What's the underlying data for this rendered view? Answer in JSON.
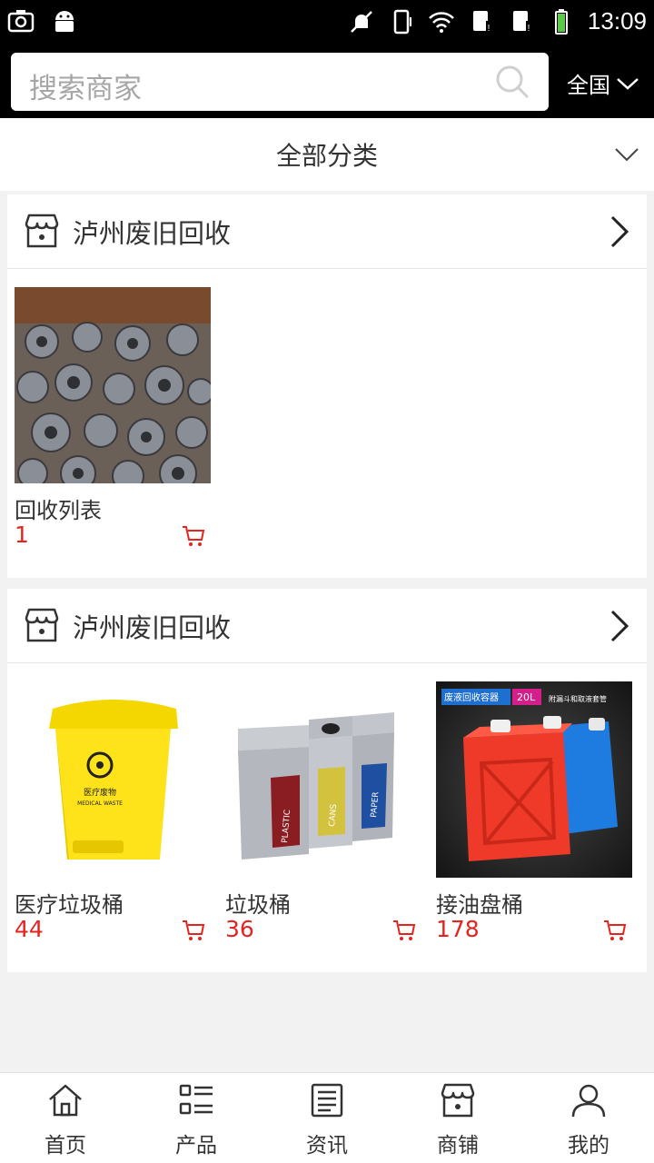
{
  "status_bar": {
    "time": "13:09",
    "icons": [
      "screenshot-icon",
      "android-icon",
      "notifications-off-icon",
      "vibrate-icon",
      "wifi-icon",
      "sim1-icon",
      "sim2-icon",
      "battery-icon"
    ]
  },
  "search": {
    "placeholder": "搜索商家",
    "region": "全国"
  },
  "category": {
    "label": "全部分类"
  },
  "sections": [
    {
      "title": "泸州废旧回收",
      "products": [
        {
          "name": "回收列表",
          "price": "1",
          "image": "scrap-motors-photo"
        }
      ]
    },
    {
      "title": "泸州废旧回收",
      "products": [
        {
          "name": "医疗垃圾桶",
          "price": "44",
          "image": "yellow-medical-bin-photo",
          "image_text": [
            "医疗废物",
            "MEDICAL WASTE"
          ]
        },
        {
          "name": "垃圾桶",
          "price": "36",
          "image": "recycling-bins-photo",
          "image_text": [
            "PLASTIC",
            "CANS",
            "PAPER"
          ]
        },
        {
          "name": "接油盘桶",
          "price": "178",
          "image": "oil-containers-photo",
          "image_text": [
            "废液回收容器",
            "20L",
            "附漏斗和取液套管"
          ]
        }
      ]
    }
  ],
  "bottom_nav": [
    {
      "label": "首页",
      "icon": "home-icon"
    },
    {
      "label": "产品",
      "icon": "product-list-icon"
    },
    {
      "label": "资讯",
      "icon": "news-icon"
    },
    {
      "label": "商铺",
      "icon": "store-icon"
    },
    {
      "label": "我的",
      "icon": "user-icon"
    }
  ],
  "colors": {
    "price": "#e3241f",
    "header_bg": "#000000",
    "page_bg": "#f2f2f2"
  }
}
